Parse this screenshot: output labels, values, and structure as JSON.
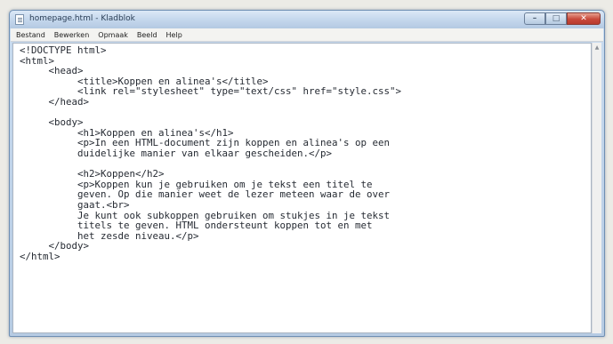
{
  "window": {
    "title": "homepage.html - Kladblok",
    "buttons": {
      "minimize": "–",
      "maximize": "□",
      "close": "✕"
    }
  },
  "menu": [
    "Bestand",
    "Bewerken",
    "Opmaak",
    "Beeld",
    "Help"
  ],
  "editor": {
    "lines": [
      "<!DOCTYPE html>",
      "<html>",
      "     <head>",
      "          <title>Koppen en alinea's</title>",
      "          <link rel=\"stylesheet\" type=\"text/css\" href=\"style.css\">",
      "     </head>",
      "",
      "     <body>",
      "          <h1>Koppen en alinea's</h1>",
      "          <p>In een HTML-document zijn koppen en alinea's op een",
      "          duidelijke manier van elkaar gescheiden.</p>",
      "",
      "          <h2>Koppen</h2>",
      "          <p>Koppen kun je gebruiken om je tekst een titel te",
      "          geven. Op die manier weet de lezer meteen waar de over",
      "          gaat.<br>",
      "          Je kunt ook subkoppen gebruiken om stukjes in je tekst",
      "          titels te geven. HTML ondersteunt koppen tot en met",
      "          het zesde niveau.</p>",
      "     </body>",
      "</html>"
    ]
  },
  "icons": {
    "app": "notepad-icon",
    "scroll_up": "arrow-up-icon"
  }
}
